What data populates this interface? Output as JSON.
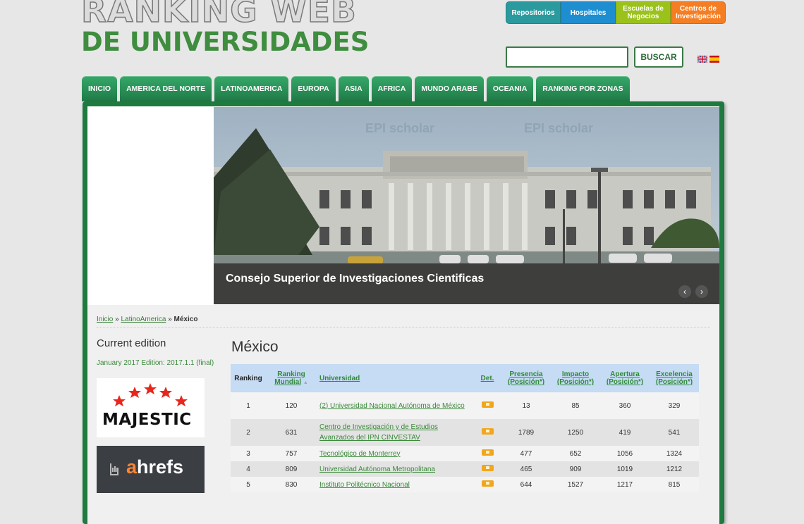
{
  "logo": {
    "line1": "RANKING WEB",
    "line2": "DE UNIVERSIDADES"
  },
  "top_links": [
    {
      "label": "Repositorios",
      "color": "#2b9a9e"
    },
    {
      "label": "Hospitales",
      "color": "#1f8ed1"
    },
    {
      "label": "Escuelas de Negocios",
      "color": "#9ac21b"
    },
    {
      "label": "Centros de Investigación",
      "color": "#f57d22"
    }
  ],
  "search": {
    "value": "",
    "button": "BUSCAR"
  },
  "languages": [
    "en-flag-icon",
    "es-flag-icon"
  ],
  "nav": [
    "INICIO",
    "AMERICA DEL NORTE",
    "LATINOAMERICA",
    "EUROPA",
    "ASIA",
    "AFRICA",
    "MUNDO ARABE",
    "OCEANIA",
    "RANKING POR ZONAS"
  ],
  "slider": {
    "watermark1": "EPI scholar",
    "watermark2": "EPI scholar",
    "caption": "Consejo Superior de Investigaciones Cientificas",
    "prev": "‹",
    "next": "›"
  },
  "breadcrumb": {
    "home": "Inicio",
    "sep": "»",
    "region": "LatinoAmerica",
    "current": "México"
  },
  "sidebar": {
    "title": "Current edition",
    "edition": "January 2017 Edition: 2017.1.1 (final)",
    "majestic": "MAJESTIC",
    "ahrefs_a": "a",
    "ahrefs_rest": "hrefs"
  },
  "page_title": "México",
  "table": {
    "headers": {
      "ranking": "Ranking",
      "mundial": "Ranking Mundial",
      "sort": "▲",
      "universidad": "Universidad",
      "det": "Det.",
      "presencia": "Presencia (Posición*)",
      "impacto": "Impacto (Posición*)",
      "apertura": "Apertura (Posición*)",
      "excelencia": "Excelencia (Posición*)"
    },
    "rows": [
      {
        "rank": "1",
        "world": "120",
        "name": "(2) Universidad Nacional Autónoma de México",
        "presencia": "13",
        "impacto": "85",
        "apertura": "360",
        "excelencia": "329"
      },
      {
        "rank": "2",
        "world": "631",
        "name": "Centro de Investigación y de Estudios Avanzados del IPN CINVESTAV",
        "presencia": "1789",
        "impacto": "1250",
        "apertura": "419",
        "excelencia": "541"
      },
      {
        "rank": "3",
        "world": "757",
        "name": "Tecnológico de Monterrey",
        "presencia": "477",
        "impacto": "652",
        "apertura": "1056",
        "excelencia": "1324"
      },
      {
        "rank": "4",
        "world": "809",
        "name": "Universidad Autónoma Metropolitana",
        "presencia": "465",
        "impacto": "909",
        "apertura": "1019",
        "excelencia": "1212"
      },
      {
        "rank": "5",
        "world": "830",
        "name": "Instituto Politécnico Nacional",
        "presencia": "644",
        "impacto": "1527",
        "apertura": "1217",
        "excelencia": "815"
      }
    ]
  }
}
